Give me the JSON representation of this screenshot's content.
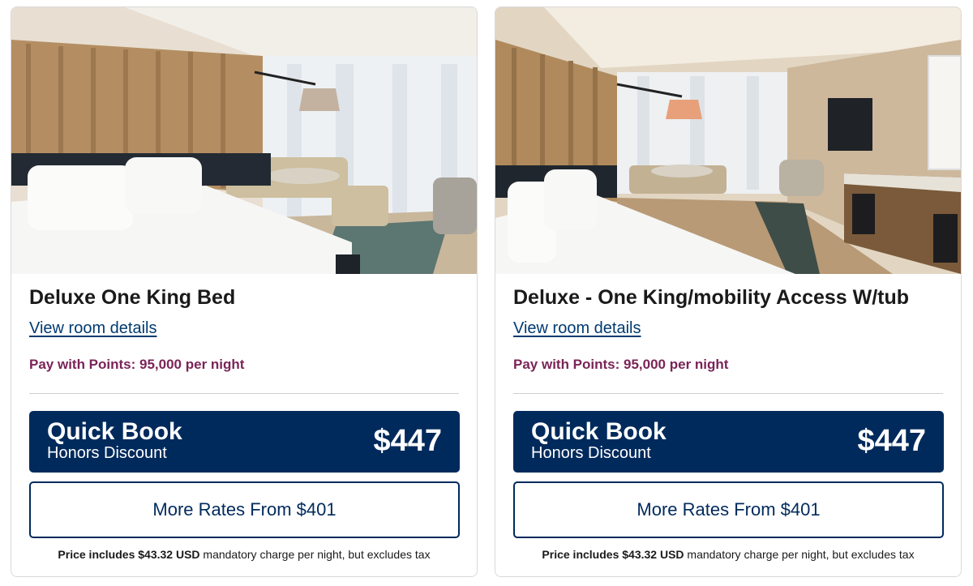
{
  "rooms": [
    {
      "photo_alt": "Deluxe One King Bed room photo",
      "title": "Deluxe One King Bed",
      "details_link": "View room details",
      "points": "Pay with Points: 95,000 per night",
      "quick_book": {
        "title": "Quick Book",
        "subtitle": "Honors Discount",
        "price": "$447"
      },
      "more_rates": "More Rates From $401",
      "price_note": {
        "bold_prefix": "Price includes $43.32 USD",
        "suffix": " mandatory charge per night, but excludes tax"
      }
    },
    {
      "photo_alt": "Deluxe One King mobility access room photo",
      "title": "Deluxe - One King/mobility Access W/tub",
      "details_link": "View room details",
      "points": "Pay with Points: 95,000 per night",
      "quick_book": {
        "title": "Quick Book",
        "subtitle": "Honors Discount",
        "price": "$447"
      },
      "more_rates": "More Rates From $401",
      "price_note": {
        "bold_prefix": "Price includes $43.32 USD",
        "suffix": " mandatory charge per night, but excludes tax"
      }
    }
  ],
  "colors": {
    "brand_navy": "#002a5c",
    "link_blue": "#003a70",
    "points_plum": "#7a2457"
  }
}
